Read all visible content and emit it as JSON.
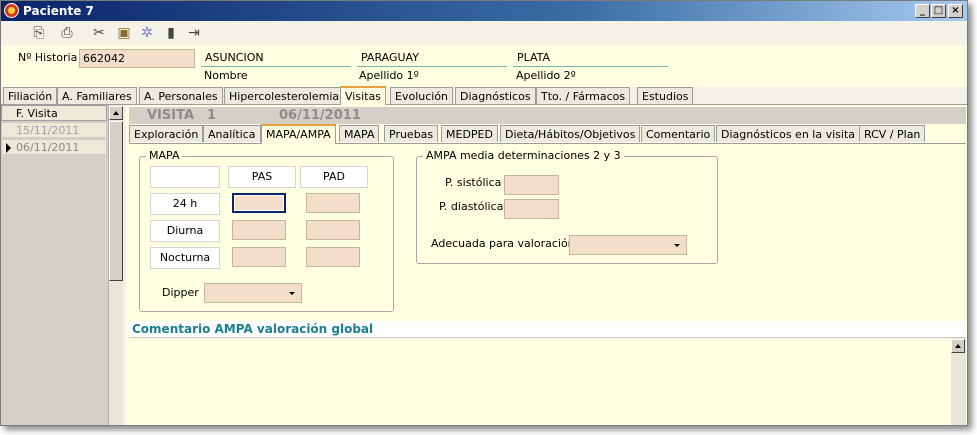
{
  "window": {
    "title": "Paciente 7",
    "min": "_",
    "max": "□",
    "close": "×"
  },
  "toolbar": {
    "icons": [
      "copy-icon",
      "print-icon",
      "tools-icon",
      "folder-icon",
      "network-icon",
      "trash-icon",
      "exit-icon"
    ]
  },
  "patient": {
    "historia_label": "Nº Historia",
    "historia": "662042",
    "nombre": "ASUNCION",
    "nombre_label": "Nombre",
    "apellido1": "PARAGUAY",
    "apellido1_label": "Apellido 1º",
    "apellido2": "PLATA",
    "apellido2_label": "Apellido 2º"
  },
  "main_tabs": [
    "Filiación",
    "A. Familiares",
    "A. Personales",
    "Hipercolesterolemia",
    "Visitas",
    "Evolución",
    "Diagnósticos",
    "Tto. / Fármacos",
    "Estudios"
  ],
  "visits": {
    "header": "F. Visita",
    "rows": [
      "15/11/2011",
      "06/11/2011"
    ]
  },
  "visit_banner": {
    "label": "VISITA",
    "number": "1",
    "date": "06/11/2011"
  },
  "sub_tabs": [
    "Exploración",
    "Analítica",
    "MAPA/AMPA",
    "MAPA",
    "Pruebas",
    "MEDPED",
    "Dieta/Hábitos/Objetivos",
    "Comentario",
    "Diagnósticos en la visita",
    "RCV / Plan"
  ],
  "mapa": {
    "legend": "MAPA",
    "col_pas": "PAS",
    "col_pad": "PAD",
    "row_24h": "24 h",
    "row_diurna": "Diurna",
    "row_nocturna": "Nocturna",
    "dipper": "Dipper"
  },
  "ampa": {
    "legend": "AMPA media determinaciones 2 y 3",
    "sistolica": "P. sistólica",
    "diastolica": "P. diastólica",
    "adecuada": "Adecuada para valoración"
  },
  "comment": {
    "title": "Comentario AMPA valoración global"
  }
}
